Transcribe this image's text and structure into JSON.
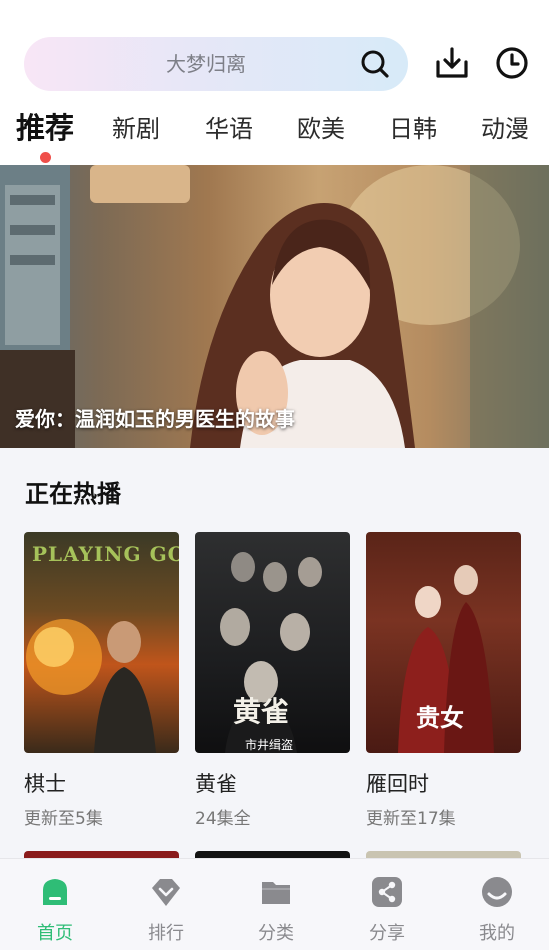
{
  "search": {
    "placeholder": "大梦归离"
  },
  "tabs": [
    "推荐",
    "新剧",
    "华语",
    "欧美",
    "日韩",
    "动漫"
  ],
  "banner": {
    "caption": "爱你：温润如玉的男医生的故事"
  },
  "section": {
    "title": "正在热播",
    "cards": [
      {
        "title": "棋士",
        "subtitle": "更新至5集",
        "poster_text": "PLAYING GO"
      },
      {
        "title": "黄雀",
        "subtitle": "24集全",
        "poster_text": "黄雀",
        "poster_sub": "市井缉盗"
      },
      {
        "title": "雁回时",
        "subtitle": "更新至17集",
        "poster_text": "贵女"
      }
    ]
  },
  "bottom_nav": [
    {
      "label": "首页",
      "icon": "home-icon",
      "active": true
    },
    {
      "label": "排行",
      "icon": "ranking-icon",
      "active": false
    },
    {
      "label": "分类",
      "icon": "folder-icon",
      "active": false
    },
    {
      "label": "分享",
      "icon": "share-icon",
      "active": false
    },
    {
      "label": "我的",
      "icon": "profile-icon",
      "active": false
    }
  ],
  "colors": {
    "accent": "#2fbd76",
    "tab_dot": "#ef4f4a"
  }
}
